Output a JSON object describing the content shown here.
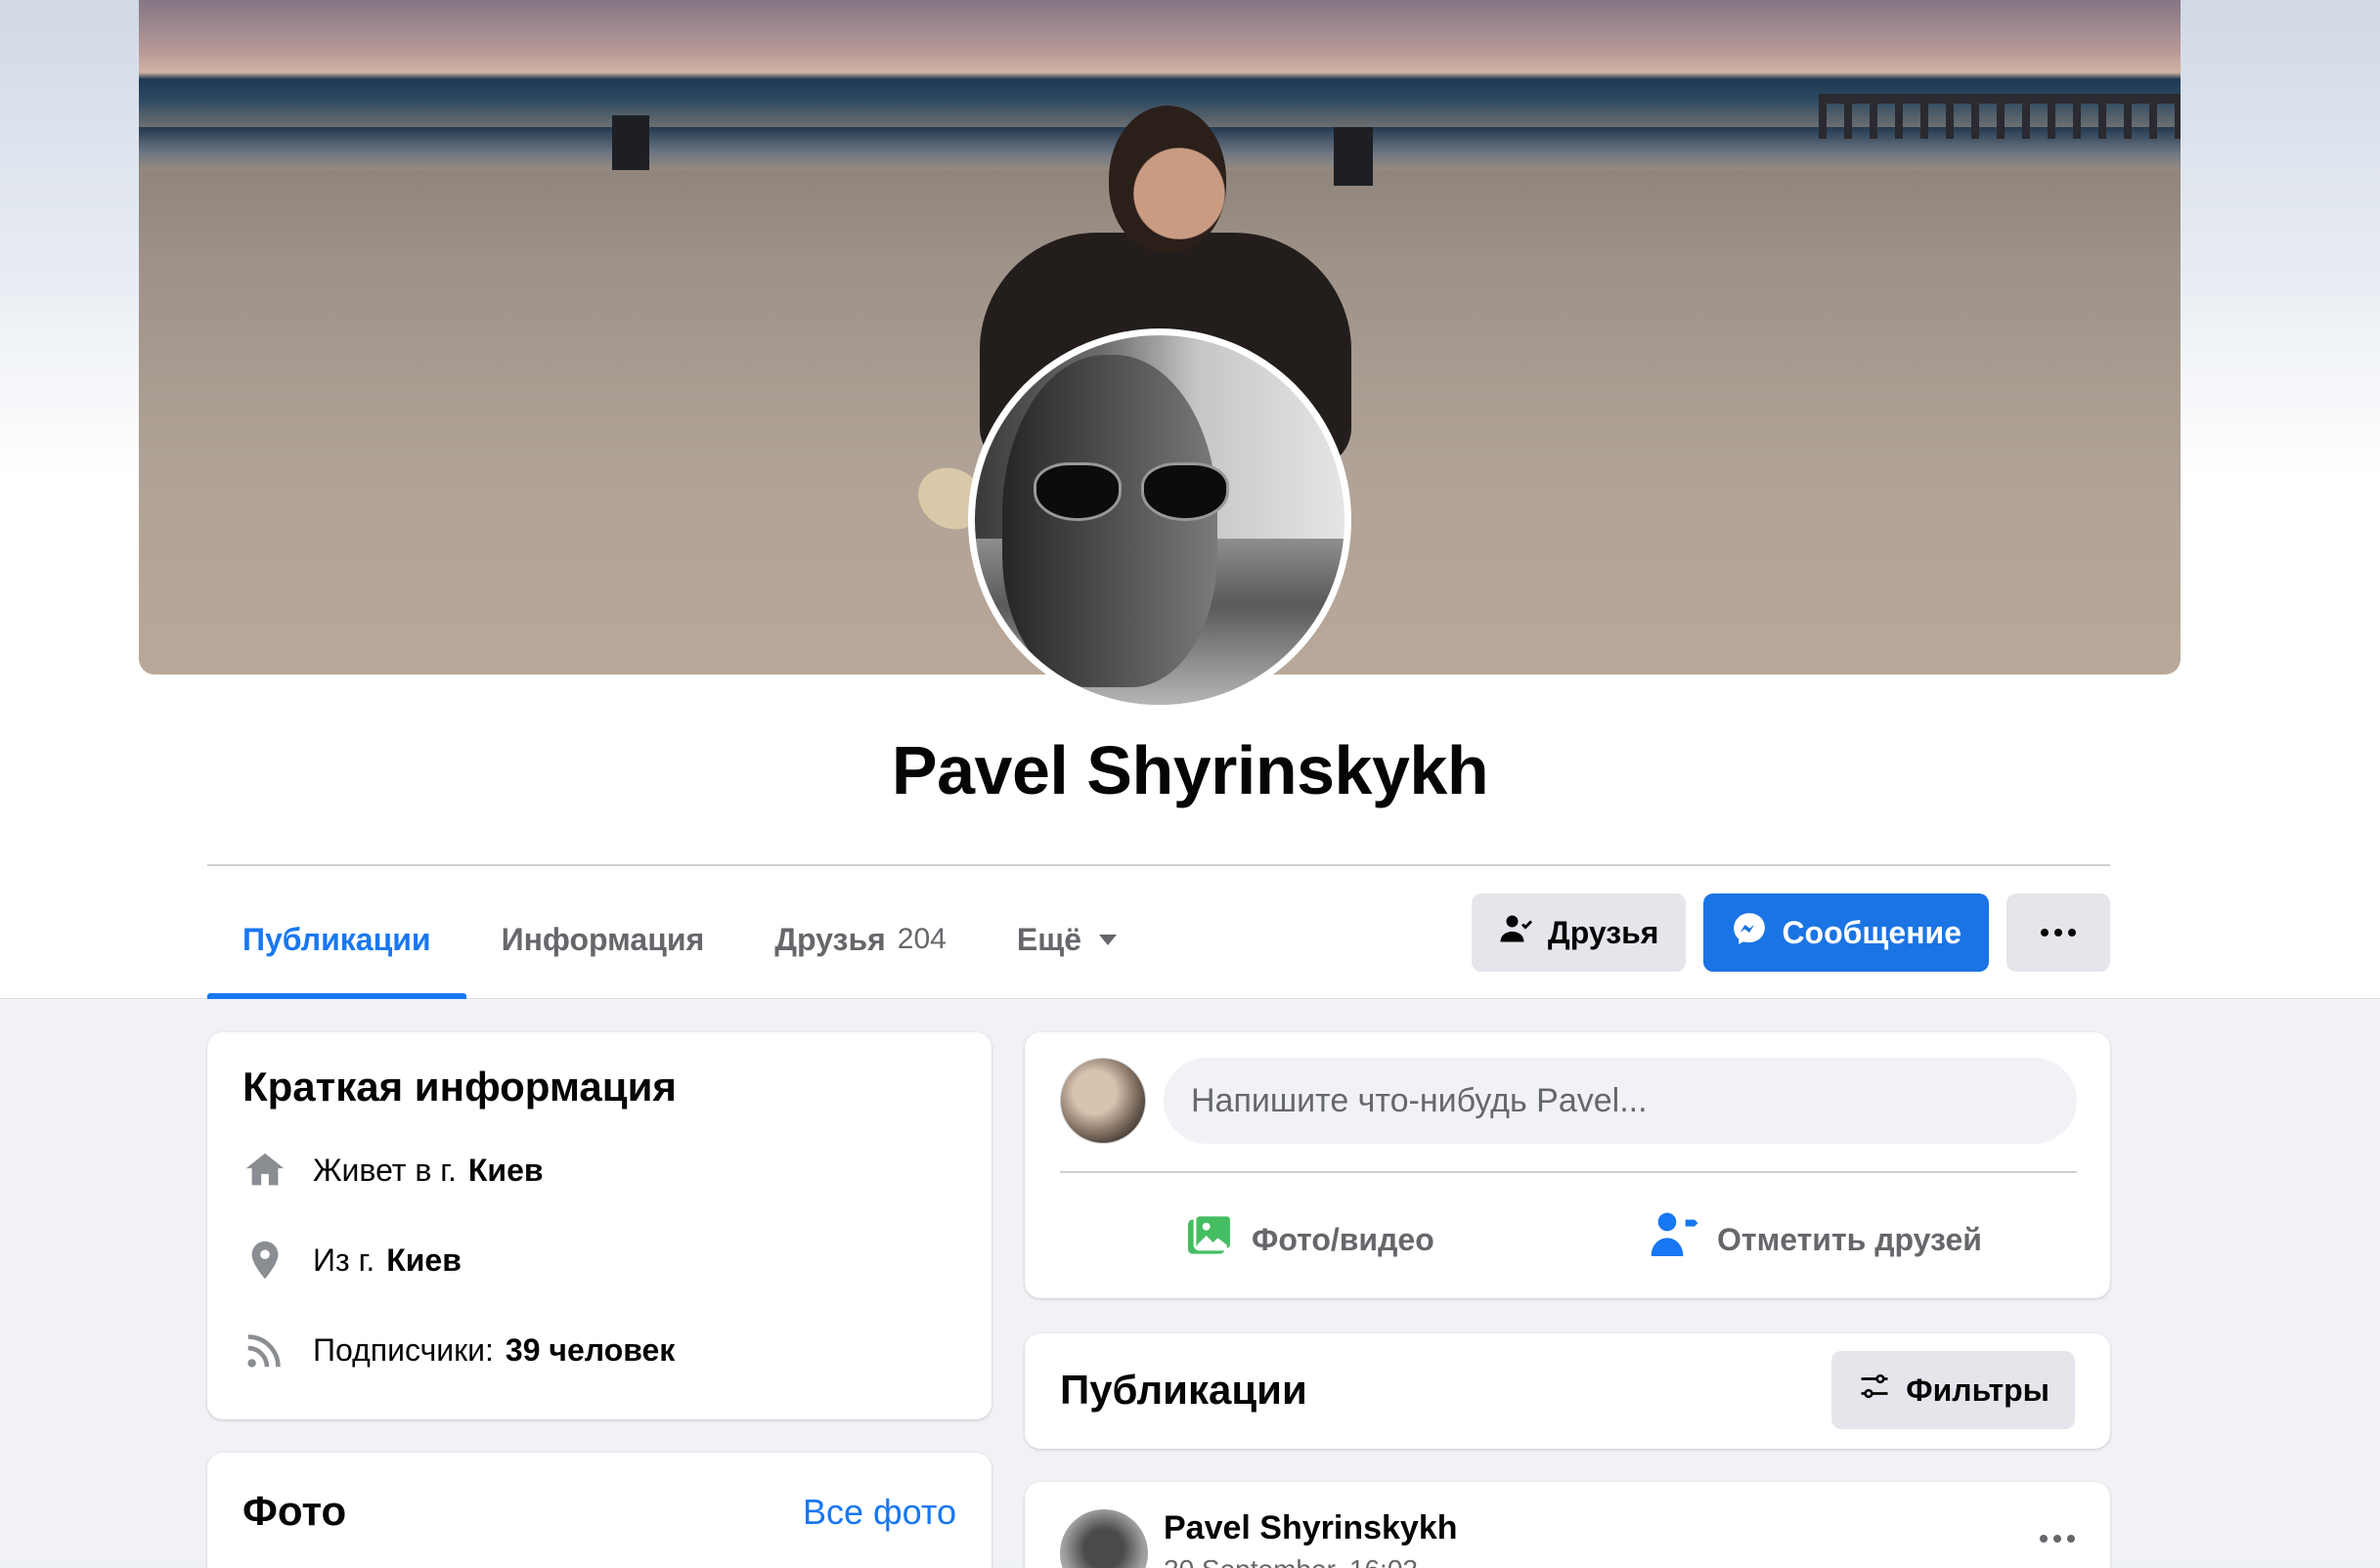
{
  "profile": {
    "name": "Pavel Shyrinskykh"
  },
  "tabs": [
    {
      "label": "Публикации",
      "count": ""
    },
    {
      "label": "Информация",
      "count": ""
    },
    {
      "label": "Друзья",
      "count": "204"
    },
    {
      "label": "Ещё",
      "count": ""
    }
  ],
  "actions": {
    "friends": "Друзья",
    "message": "Сообщение"
  },
  "intro": {
    "title": "Краткая информация",
    "lives_prefix": "Живет в г.",
    "lives_city": "Киев",
    "from_prefix": "Из г.",
    "from_city": "Киев",
    "followers_prefix": "Подписчики:",
    "followers_value": "39 человек"
  },
  "photos": {
    "title": "Фото",
    "all_link": "Все фото"
  },
  "composer": {
    "placeholder": "Напишите что-нибудь Pavel...",
    "photo_video": "Фото/видео",
    "tag_friends": "Отметить друзей"
  },
  "publications": {
    "title": "Публикации",
    "filters": "Фильтры"
  },
  "post": {
    "author": "Pavel Shyrinskykh",
    "date": "20 September, 16:02 ·"
  },
  "icons": {
    "home": "home-icon",
    "location": "location-pin-icon",
    "rss": "followers-icon",
    "photo": "photo-video-icon",
    "tag": "tag-friends-icon",
    "filters": "filters-icon",
    "messenger": "messenger-icon",
    "friend": "friend-check-icon"
  },
  "colors": {
    "accent": "#1877f2",
    "button_blue": "#1b74e4",
    "button_gray": "#e4e6eb",
    "secondary_text": "#65676b",
    "background": "#f0f2f5",
    "photo_green": "#45bd62"
  }
}
